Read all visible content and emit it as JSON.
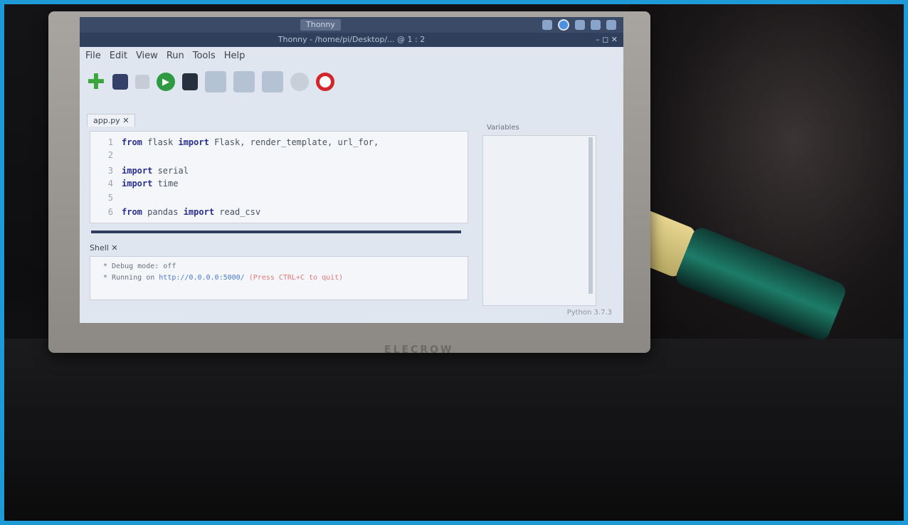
{
  "taskbar": {
    "thonny_button": "Thonny"
  },
  "titlebar": {
    "title": "Thonny  -  /home/pi/Desktop/...  @  1 : 2",
    "controls": "– ◻ ✕"
  },
  "menubar": {
    "items": [
      "File",
      "Edit",
      "View",
      "Run",
      "Tools",
      "Help"
    ]
  },
  "toolbar": {
    "run_glyph": "▶"
  },
  "editor": {
    "tab_label": "app.py",
    "lines": [
      {
        "n": "1",
        "kw": "from",
        "rest": " flask ",
        "kw2": "import",
        "rest2": " Flask, render_template, url_for,"
      },
      {
        "n": "2",
        "kw": "",
        "rest": "",
        "kw2": "",
        "rest2": ""
      },
      {
        "n": "3",
        "kw": "import",
        "rest": " serial",
        "kw2": "",
        "rest2": ""
      },
      {
        "n": "4",
        "kw": "import",
        "rest": " time",
        "kw2": "",
        "rest2": ""
      },
      {
        "n": "5",
        "kw": "",
        "rest": "",
        "kw2": "",
        "rest2": ""
      },
      {
        "n": "6",
        "kw": "from",
        "rest": " pandas ",
        "kw2": "import",
        "rest2": " read_csv"
      }
    ]
  },
  "shell": {
    "tab_label": "Shell",
    "line1": "* Debug mode: off",
    "line2_prefix": "* Running on ",
    "line2_url": "http://0.0.0.0:5000/",
    "line2_suffix": " (Press CTRL+C to quit)"
  },
  "side_panel": {
    "tab_label": "Variables"
  },
  "status": {
    "text": "Python 3.7.3"
  },
  "monitor": {
    "brand": "ELECROW"
  }
}
